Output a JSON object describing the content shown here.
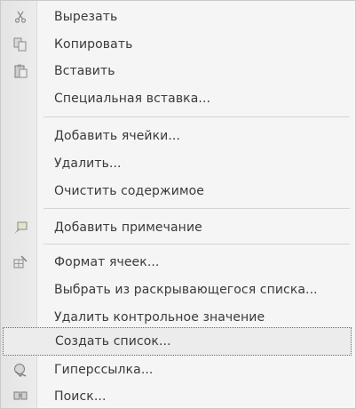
{
  "menu": {
    "items": [
      {
        "label": "Вырезать",
        "icon": "scissors-icon"
      },
      {
        "label": "Копировать",
        "icon": "copy-icon"
      },
      {
        "label": "Вставить",
        "icon": "paste-icon"
      },
      {
        "label": "Специальная вставка...",
        "icon": ""
      },
      {
        "label": "Добавить ячейки...",
        "icon": ""
      },
      {
        "label": "Удалить...",
        "icon": ""
      },
      {
        "label": "Очистить содержимое",
        "icon": ""
      },
      {
        "label": "Добавить примечание",
        "icon": "comment-icon"
      },
      {
        "label": "Формат ячеек...",
        "icon": "format-cells-icon"
      },
      {
        "label": "Выбрать из раскрывающегося списка...",
        "icon": ""
      },
      {
        "label": "Удалить контрольное значение",
        "icon": ""
      },
      {
        "label": "Создать список...",
        "icon": ""
      },
      {
        "label": "Гиперссылка...",
        "icon": "hyperlink-icon"
      },
      {
        "label": "Поиск...",
        "icon": "search-icon"
      }
    ],
    "selected_index": 11
  }
}
